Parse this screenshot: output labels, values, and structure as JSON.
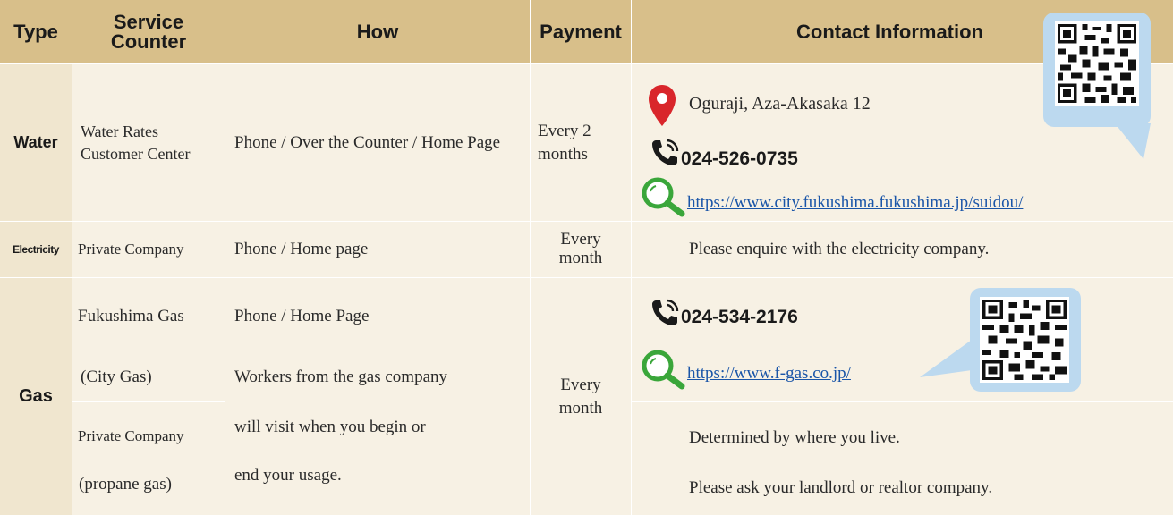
{
  "header": {
    "type": "Type",
    "service_counter": "Service Counter",
    "how": "How",
    "payment": "Payment",
    "contact": "Contact Information"
  },
  "rows": {
    "water": {
      "type": "Water",
      "counter": "Water Rates Customer Center",
      "how": "Phone / Over the Counter / Home Page",
      "payment": "Every 2 months",
      "address": "Oguraji, Aza-Akasaka 12",
      "phone": "024-526-0735",
      "url": "https://www.city.fukushima.fukushima.jp/suidou/"
    },
    "electricity": {
      "type": "Electricity",
      "counter": "Private Company",
      "how": "Phone / Home page",
      "payment": "Every month",
      "contact": "Please enquire with the electricity company."
    },
    "gas": {
      "type": "Gas",
      "counter_city": "Fukushima Gas",
      "counter_city_sub": "(City Gas)",
      "counter_private": "Private Company",
      "counter_private_sub": "(propane gas)",
      "how_1": "Phone / Home Page",
      "how_2": "Workers from the gas company",
      "how_3": "will visit when you begin or",
      "how_4": "end your usage.",
      "payment": "Every month",
      "phone": "024-534-2176",
      "url": "https://www.f-gas.co.jp/",
      "contact_private_1": "Determined by where you live.",
      "contact_private_2": "Please ask your landlord or realtor company."
    }
  },
  "icons": {
    "location": "location-pin-icon",
    "phone": "phone-icon",
    "search": "search-magnifier-icon",
    "qr": "qr-code"
  },
  "colors": {
    "header_bg": "#d8bf8a",
    "type_bg": "#f0e6cf",
    "body_bg": "#f7f1e4",
    "qr_bubble": "#bcd9ef",
    "pin_red": "#d9262b",
    "search_green": "#3aa63a",
    "link_blue": "#1a55a8"
  }
}
